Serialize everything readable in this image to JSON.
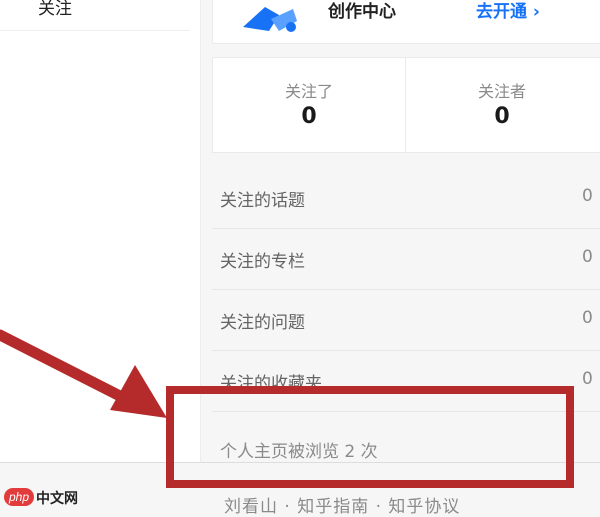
{
  "left": {
    "tab_label": "关注"
  },
  "creator": {
    "title": "创作中心",
    "link": "去开通 ›"
  },
  "stats": [
    {
      "label": "关注了",
      "value": "0"
    },
    {
      "label": "关注者",
      "value": "0"
    }
  ],
  "follows": [
    {
      "label": "关注的话题",
      "count": "0"
    },
    {
      "label": "关注的专栏",
      "count": "0"
    },
    {
      "label": "关注的问题",
      "count": "0"
    },
    {
      "label": "关注的收藏夹",
      "count": "0"
    }
  ],
  "views": {
    "text": "个人主页被浏览 2 次"
  },
  "footer": {
    "text": "刘看山 · 知乎指南 · 知乎协议"
  },
  "watermark": {
    "badge": "php",
    "text": "中文网"
  },
  "colors": {
    "annotation_red": "#b52a2a",
    "link_blue": "#1772f6"
  }
}
